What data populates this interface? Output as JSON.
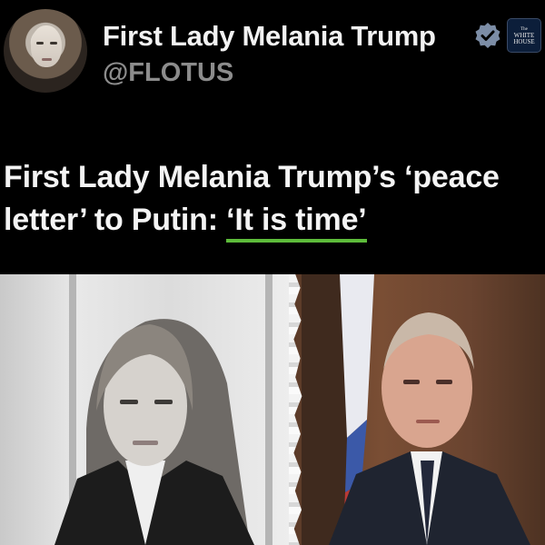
{
  "post": {
    "display_name": "First Lady Melania Trump",
    "handle": "@FLOTUS",
    "verified_icon": "verified-badge-icon",
    "affiliation_badge": [
      "The",
      "WHITE",
      "HOUSE"
    ]
  },
  "headline": {
    "part1": "First Lady Melania Trump’s ‘peace",
    "part2": "letter’ to Putin: ",
    "highlight": "‘It is time’"
  },
  "colors": {
    "background": "#000000",
    "highlight_underline": "#5dbb3a",
    "verified": "#7c8da6"
  }
}
